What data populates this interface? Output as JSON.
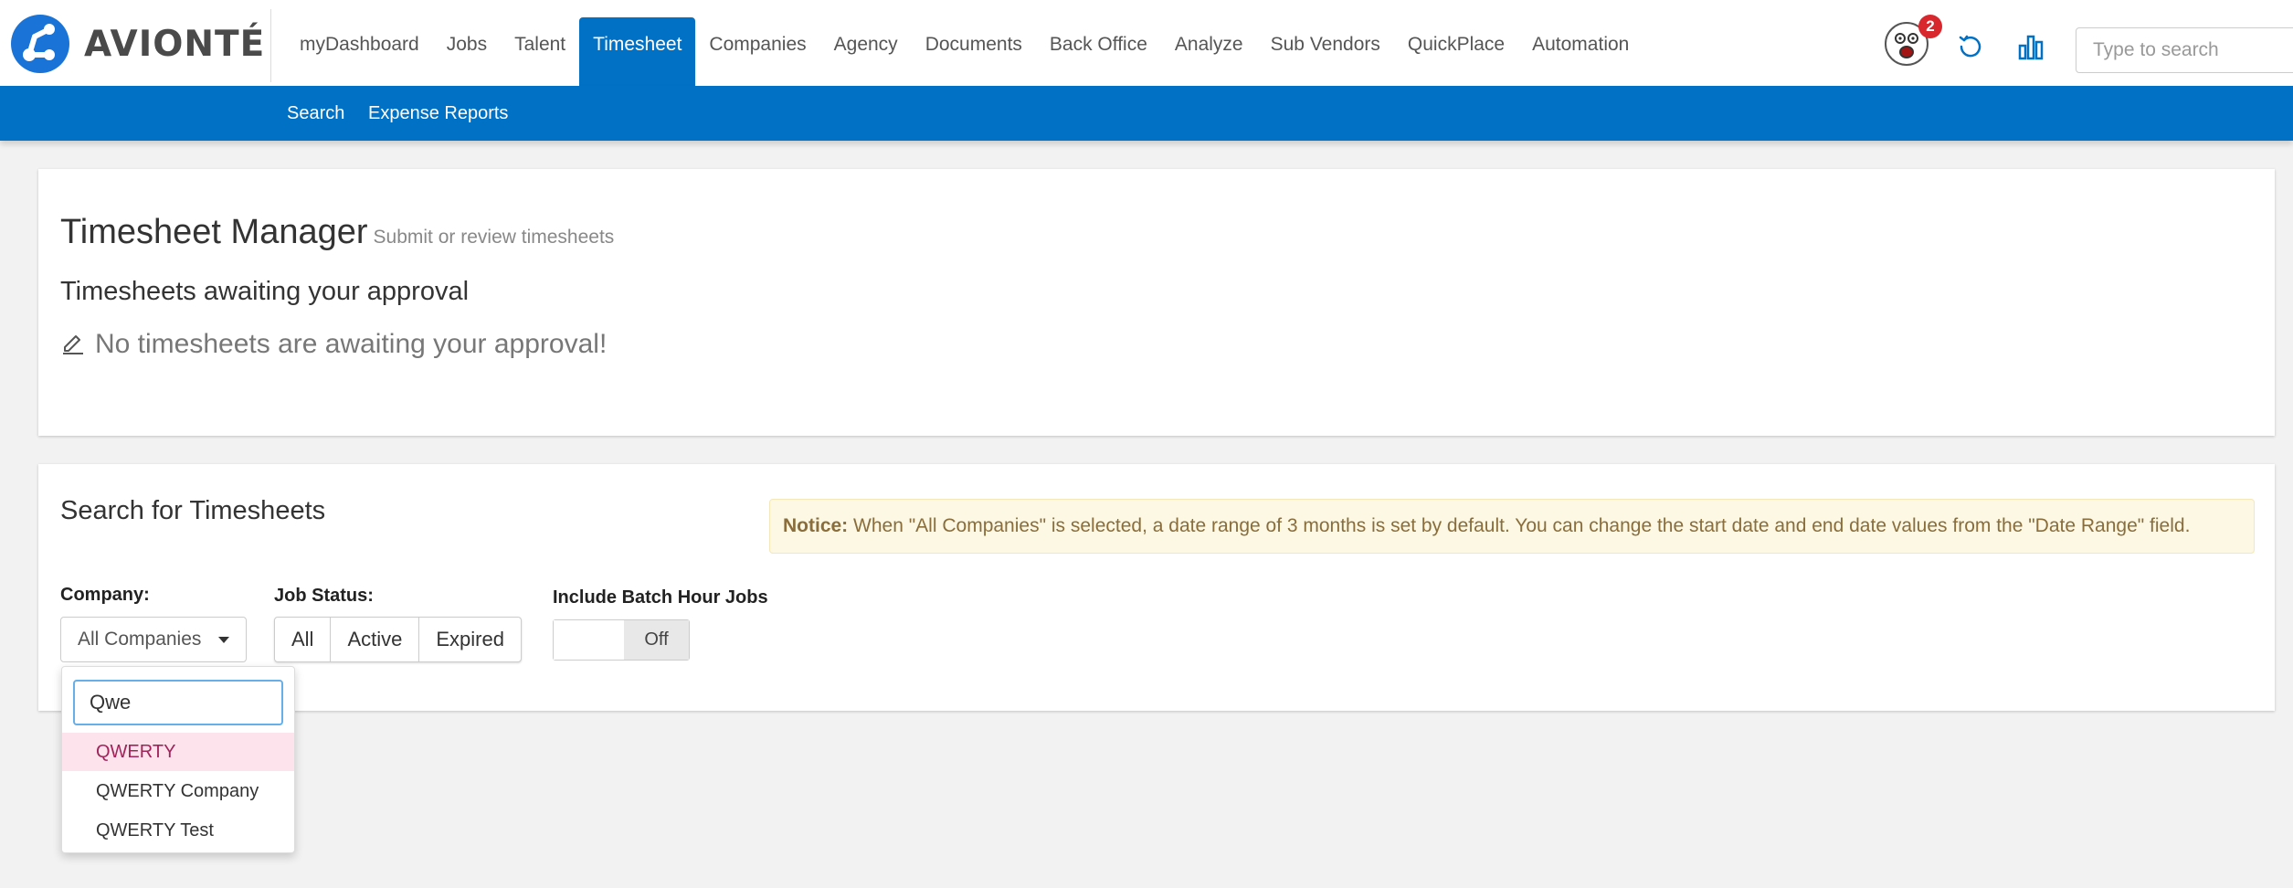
{
  "brand": {
    "name": "AVIONTÉ",
    "color": "#1a73d6"
  },
  "nav": {
    "items": [
      {
        "label": "myDashboard"
      },
      {
        "label": "Jobs"
      },
      {
        "label": "Talent"
      },
      {
        "label": "Timesheet",
        "active": true
      },
      {
        "label": "Companies"
      },
      {
        "label": "Agency"
      },
      {
        "label": "Documents"
      },
      {
        "label": "Back Office"
      },
      {
        "label": "Analyze"
      },
      {
        "label": "Sub Vendors"
      },
      {
        "label": "QuickPlace"
      },
      {
        "label": "Automation"
      }
    ],
    "accent": "#0071c5"
  },
  "header": {
    "notification_count": "2",
    "icons": [
      "avatar",
      "refresh-icon",
      "bar-chart-icon"
    ],
    "search_placeholder": "Type to search"
  },
  "subnav": {
    "items": [
      {
        "label": "Search"
      },
      {
        "label": "Expense Reports"
      }
    ]
  },
  "manager": {
    "title": "Timesheet Manager",
    "subtitle": "Submit or review timesheets",
    "awaiting_heading": "Timesheets awaiting your approval",
    "empty_message": "No timesheets are awaiting your approval!",
    "empty_icon": "edit-icon"
  },
  "search": {
    "heading": "Search for Timesheets",
    "notice_label": "Notice:",
    "notice_text": "When \"All Companies\" is selected, a date range of 3 months is set by default. You can change the start date and end date values from the \"Date Range\" field.",
    "company_label": "Company:",
    "company_value": "All Companies",
    "job_status_label": "Job Status:",
    "job_status_options": [
      "All",
      "Active",
      "Expired"
    ],
    "batch_label": "Include Batch Hour Jobs",
    "batch_toggle": "Off"
  },
  "dropdown": {
    "query": "Qwe",
    "options": [
      {
        "label": "QWERTY",
        "highlighted": true
      },
      {
        "label": "QWERTY Company"
      },
      {
        "label": "QWERTY Test"
      }
    ]
  }
}
